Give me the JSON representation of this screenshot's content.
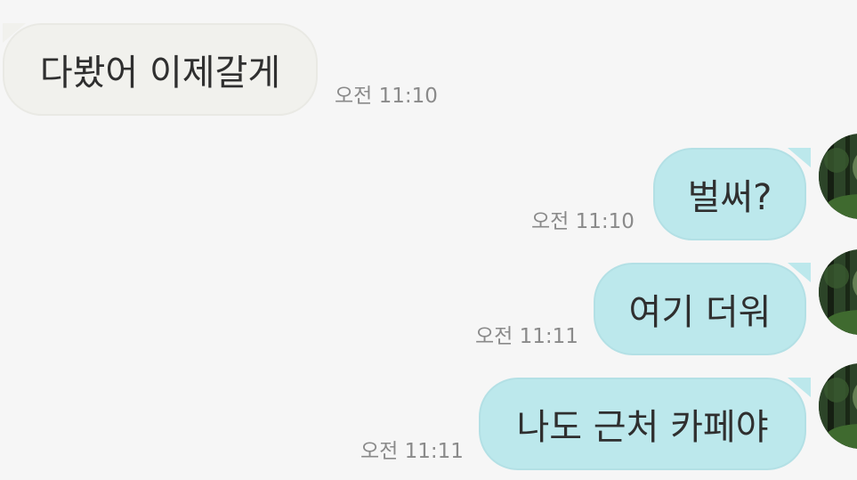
{
  "messages": [
    {
      "sender": "other",
      "text": "다봤어 이제갈게",
      "time": "오전 11:10"
    },
    {
      "sender": "me",
      "text": "벌써?",
      "time": "오전 11:10"
    },
    {
      "sender": "me",
      "text": "여기 더워",
      "time": "오전 11:11"
    },
    {
      "sender": "me",
      "text": "나도 근처 카페야",
      "time": "오전 11:11"
    }
  ],
  "avatar": {
    "icon": "profile-photo-forest-icon"
  },
  "colors": {
    "incoming_bubble": "#f1f1ed",
    "outgoing_bubble": "#bce8ec",
    "background": "#f6f6f6",
    "timestamp": "#8a8a8a"
  }
}
